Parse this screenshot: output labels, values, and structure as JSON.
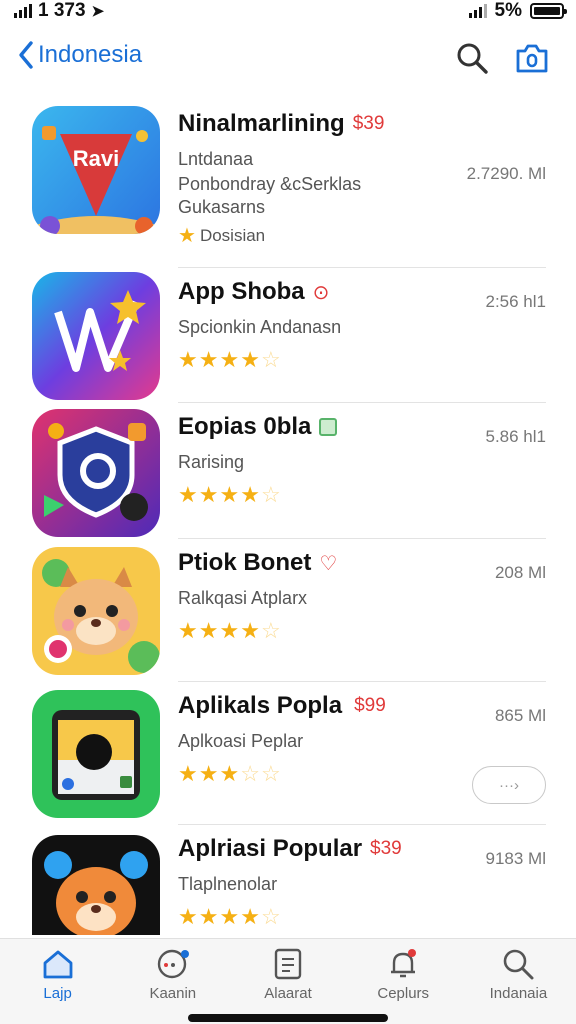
{
  "status_bar": {
    "time": "1 373",
    "battery": "5%"
  },
  "nav": {
    "back_label": "Indonesia"
  },
  "apps": [
    {
      "name": "Ninalmarlining",
      "price": "$39",
      "subtitle": "Lntdanaa",
      "description": "Ponbondray &cSerklas Gukasarns",
      "award": "Dosisian",
      "size": "2.7290. Ml",
      "rating": 0
    },
    {
      "name": "App Shoba",
      "price": "",
      "subtitle": "Spcionkin Andanasn",
      "description": "",
      "award": "",
      "size": "2:56 hl1",
      "rating": 4.5
    },
    {
      "name": "Eopias 0bla",
      "price": "",
      "subtitle": "Rarising",
      "description": "",
      "award": "",
      "size": "5.86 hl1",
      "rating": 4.5
    },
    {
      "name": "Ptiok Bonet",
      "price": "",
      "subtitle": "Ralkqasi Atplarx",
      "description": "",
      "award": "",
      "size": "208 Ml",
      "rating": 4.5
    },
    {
      "name": "Aplikals Popla",
      "price": "$99",
      "subtitle": "Aplkoasi Peplar",
      "description": "",
      "award": "",
      "size": "865 Ml",
      "rating": 3.5,
      "get_label": "···›"
    },
    {
      "name": "Aplriasi Popular",
      "price": "$39",
      "subtitle": "Tlaplnenolar",
      "description": "",
      "award": "",
      "size": "9183 Ml",
      "rating": 4.5
    }
  ],
  "tabs": [
    {
      "label": "Lajp",
      "icon": "home-icon",
      "active": true
    },
    {
      "label": "Kaanin",
      "icon": "chat-icon",
      "active": false
    },
    {
      "label": "Alaarat",
      "icon": "document-icon",
      "active": false
    },
    {
      "label": "Ceplurs",
      "icon": "bell-icon",
      "active": false
    },
    {
      "label": "Indanaia",
      "icon": "search-icon",
      "active": false
    }
  ],
  "colors": {
    "accent": "#1a6fd6",
    "price": "#e03a3a",
    "star": "#f5b014"
  }
}
